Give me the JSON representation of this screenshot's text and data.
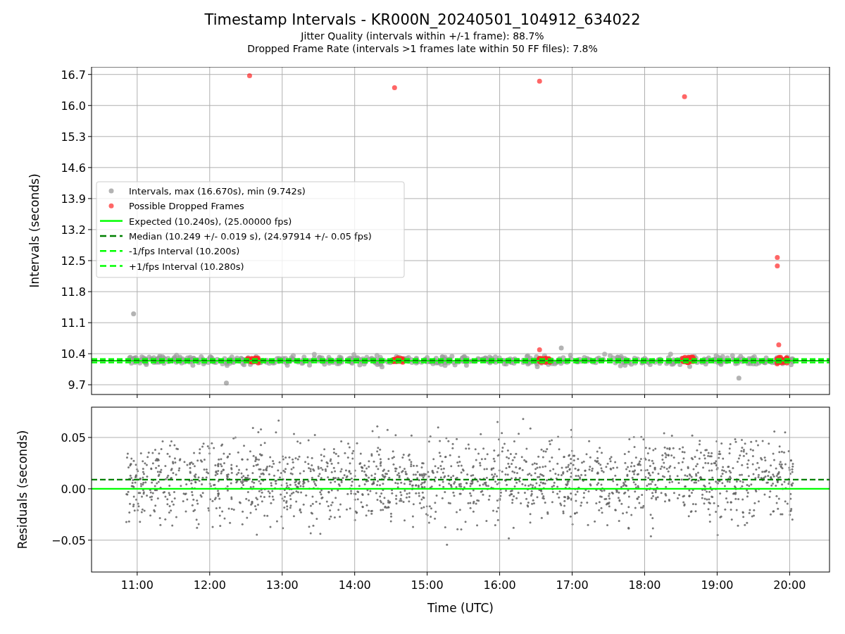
{
  "figure": {
    "title": "Timestamp Intervals - KR000N_20240501_104912_634022",
    "subtitles": [
      "Jitter Quality (intervals within +/-1 frame): 88.7%",
      "Dropped Frame Rate (intervals >1 frames late within 50 FF files): 7.8%"
    ]
  },
  "intervals_panel": {
    "chart_data": {
      "type": "scatter",
      "ylabel": "Intervals (seconds)",
      "grid": true,
      "legend": "center left",
      "xlim": [
        10.37,
        20.55
      ],
      "ylim": [
        9.48,
        16.87
      ],
      "yticks": [
        {
          "value": 9.7,
          "label": "9.7"
        },
        {
          "value": 10.4,
          "label": "10.4"
        },
        {
          "value": 11.1,
          "label": "11.1"
        },
        {
          "value": 11.8,
          "label": "11.8"
        },
        {
          "value": 12.5,
          "label": "12.5"
        },
        {
          "value": 13.2,
          "label": "13.2"
        },
        {
          "value": 13.9,
          "label": "13.9"
        },
        {
          "value": 14.6,
          "label": "14.6"
        },
        {
          "value": 15.3,
          "label": "15.3"
        },
        {
          "value": 16,
          "label": "16.0"
        },
        {
          "value": 16.7,
          "label": "16.7"
        }
      ],
      "series": [
        {
          "name": "Intervals, max (16.670s), min (9.742s)",
          "color": "#808080",
          "x": [
            10.95,
            12.23,
            16.85,
            19.3
          ],
          "values": [
            11.3,
            9.74,
            10.53,
            9.85
          ]
        },
        {
          "name": "Possible Dropped Frames",
          "color": "#ff0000",
          "x": [
            12.55,
            14.55,
            16.55,
            18.55,
            19.83,
            19.83,
            19.85,
            16.55
          ],
          "values": [
            16.67,
            16.4,
            16.55,
            16.2,
            12.57,
            12.38,
            10.6,
            10.49
          ]
        }
      ],
      "ref_lines": [
        {
          "axis": "y",
          "value": 10.24,
          "label": "Expected (10.240s), (25.00000 fps)",
          "color": "#00ff00"
        },
        {
          "axis": "y",
          "value": 10.249,
          "label": "Median (10.249 +/- 0.019 s), (24.97914 +/- 0.05 fps)",
          "color": "#008000"
        },
        {
          "axis": "y",
          "value": 10.2,
          "label": "-1/fps Interval (10.200s)",
          "color": "#00ff00"
        },
        {
          "axis": "y",
          "value": 10.28,
          "label": "+1/fps Interval (10.280s)",
          "color": "#00ff00"
        }
      ]
    }
  },
  "residuals_panel": {
    "chart_data": {
      "type": "scatter",
      "xlabel": "Time (UTC)",
      "ylabel": "Residuals (seconds)",
      "grid": true,
      "xlim": [
        10.37,
        20.55
      ],
      "ylim": [
        -0.081,
        0.0795
      ],
      "xticks": [
        {
          "value": 11,
          "label": "11:00"
        },
        {
          "value": 12,
          "label": "12:00"
        },
        {
          "value": 13,
          "label": "13:00"
        },
        {
          "value": 14,
          "label": "14:00"
        },
        {
          "value": 15,
          "label": "15:00"
        },
        {
          "value": 16,
          "label": "16:00"
        },
        {
          "value": 17,
          "label": "17:00"
        },
        {
          "value": 18,
          "label": "18:00"
        },
        {
          "value": 19,
          "label": "19:00"
        },
        {
          "value": 20,
          "label": "20:00"
        }
      ],
      "yticks": [
        {
          "value": -0.05,
          "label": "−0.05"
        },
        {
          "value": 0,
          "label": "0.00"
        },
        {
          "value": 0.05,
          "label": "0.05"
        }
      ],
      "ref_lines": [
        {
          "axis": "y",
          "value": 0,
          "color": "#00ff00"
        },
        {
          "axis": "y",
          "value": 0.009,
          "color": "#008000"
        }
      ]
    }
  }
}
